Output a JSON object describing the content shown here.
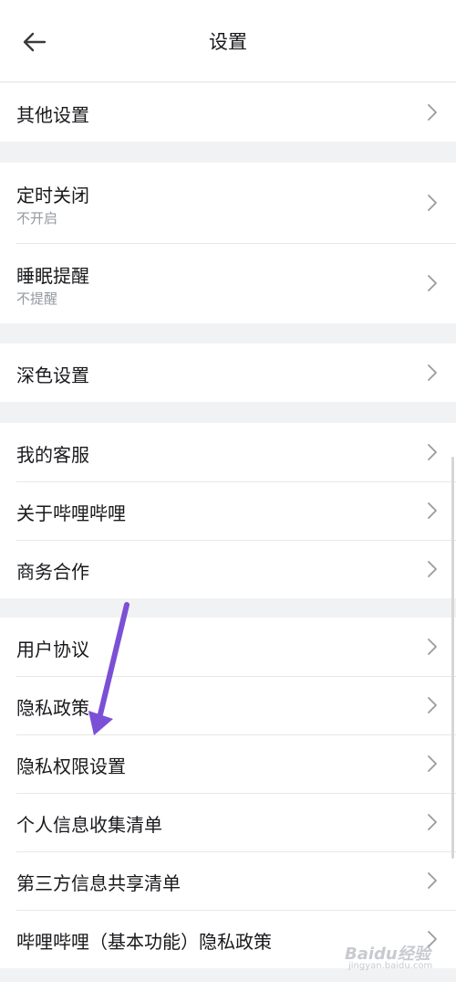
{
  "header": {
    "title": "设置"
  },
  "groups": [
    {
      "items": [
        {
          "label": "其他设置"
        }
      ]
    },
    {
      "items": [
        {
          "label": "定时关闭",
          "sub": "不开启"
        },
        {
          "label": "睡眠提醒",
          "sub": "不提醒"
        }
      ]
    },
    {
      "items": [
        {
          "label": "深色设置"
        }
      ]
    },
    {
      "items": [
        {
          "label": "我的客服"
        },
        {
          "label": "关于哔哩哔哩"
        },
        {
          "label": "商务合作"
        }
      ]
    },
    {
      "items": [
        {
          "label": "用户协议"
        },
        {
          "label": "隐私政策"
        },
        {
          "label": "隐私权限设置"
        },
        {
          "label": "个人信息收集清单"
        },
        {
          "label": "第三方信息共享清单"
        },
        {
          "label": "哔哩哔哩（基本功能）隐私政策"
        }
      ]
    }
  ],
  "annotation": {
    "arrow_color": "#7b4fd6"
  },
  "watermark": {
    "text": "Baidu经验",
    "sub": "jingyan.baidu.com"
  }
}
